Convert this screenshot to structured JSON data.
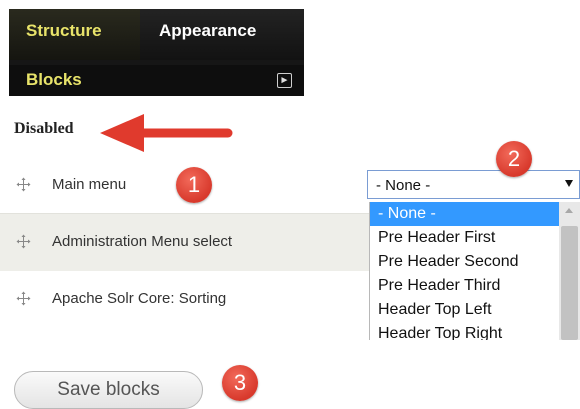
{
  "toolbar": {
    "tabs": [
      {
        "label": "Structure"
      },
      {
        "label": "Appearance"
      }
    ],
    "active_item": "Blocks",
    "expand_icon": "expand-icon"
  },
  "region": {
    "heading": "Disabled"
  },
  "blocks": [
    {
      "label": "Main menu"
    },
    {
      "label": "Administration Menu select"
    },
    {
      "label": "Apache Solr Core: Sorting"
    }
  ],
  "region_select": {
    "selected_value": "- None -",
    "options": [
      "- None -",
      "Pre Header First",
      "Pre Header Second",
      "Pre Header Third",
      "Header Top Left",
      "Header Top Right"
    ]
  },
  "badges": [
    "1",
    "2",
    "3"
  ],
  "actions": {
    "save_label": "Save blocks"
  },
  "colors": {
    "toolbar_bg": "#161616",
    "active_text": "#e8e36a",
    "badge_red": "#d8392c",
    "annotation_arrow": "#e03a2d",
    "option_highlight": "#3399ff",
    "row_stripe": "#eeeee9"
  }
}
